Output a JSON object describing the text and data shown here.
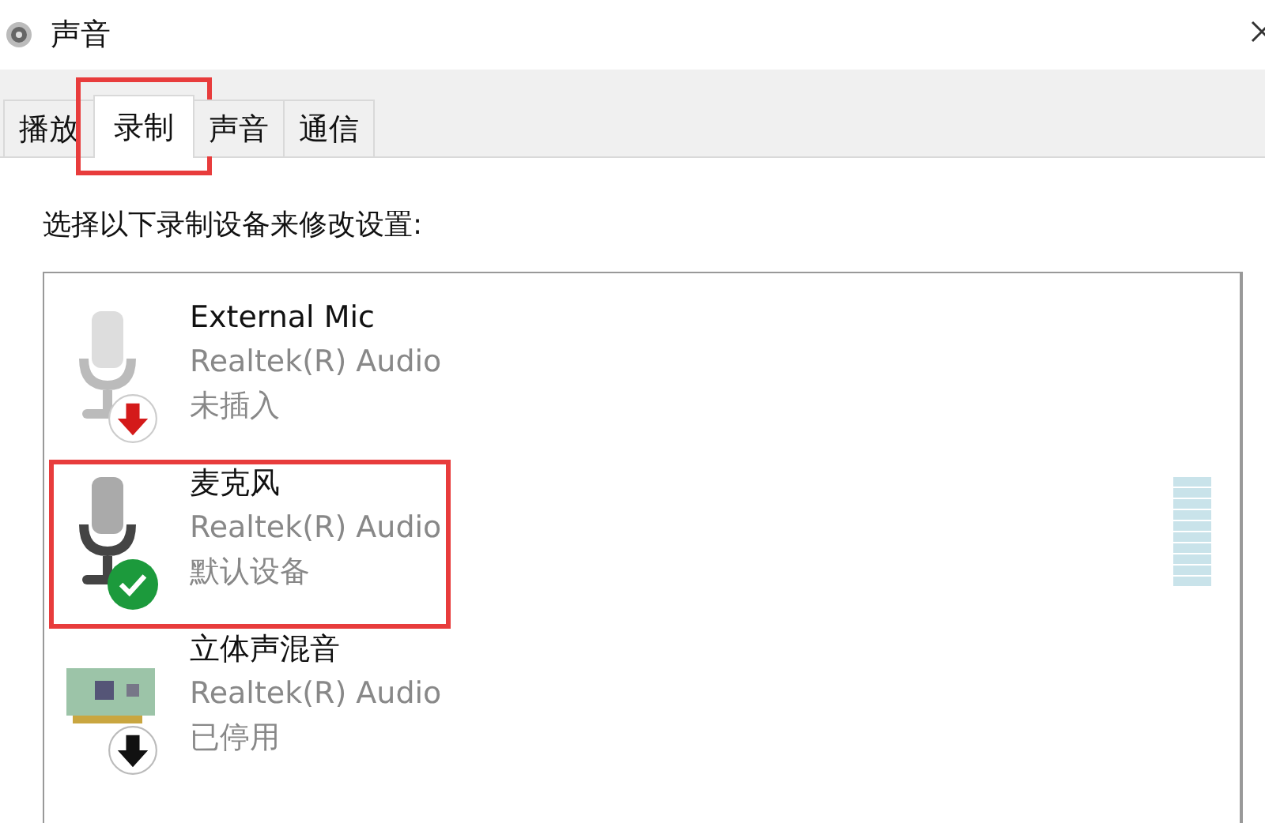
{
  "window": {
    "title": "声音"
  },
  "tabs": [
    {
      "label": "播放",
      "selected": false,
      "highlighted": false
    },
    {
      "label": "录制",
      "selected": true,
      "highlighted": true
    },
    {
      "label": "声音",
      "selected": false,
      "highlighted": false
    },
    {
      "label": "通信",
      "selected": false,
      "highlighted": false
    }
  ],
  "instruction": "选择以下录制设备来修改设置:",
  "devices": [
    {
      "kind": "mic",
      "name": "External Mic",
      "driver": "Realtek(R) Audio",
      "status_text": "未插入",
      "badge": {
        "kind": "unplugged"
      },
      "highlighted": false
    },
    {
      "kind": "mic",
      "name": "麦克风",
      "driver": "Realtek(R) Audio",
      "status_text": "默认设备",
      "badge": {
        "kind": "default"
      },
      "highlighted": true
    },
    {
      "kind": "card",
      "name": "立体声混音",
      "driver": "Realtek(R) Audio",
      "status_text": "已停用",
      "badge": {
        "kind": "disabled"
      },
      "highlighted": false
    }
  ]
}
